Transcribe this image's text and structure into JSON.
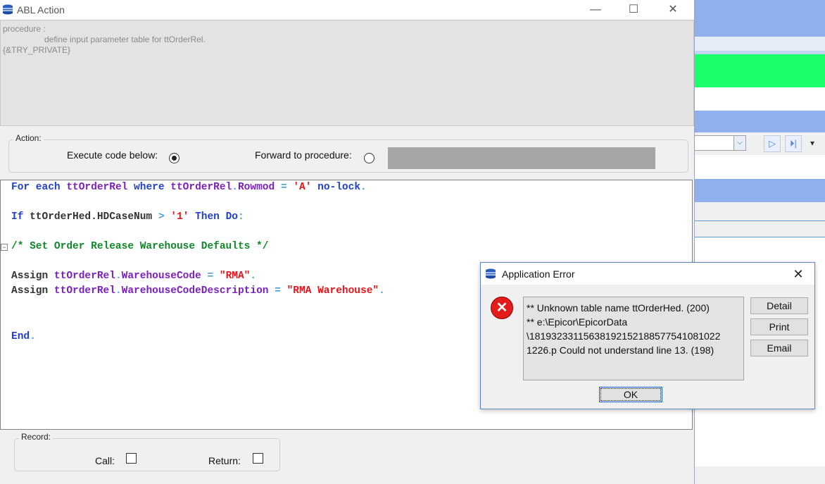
{
  "window": {
    "title": "ABL Action",
    "controls": {
      "minimize": "—",
      "maximize": "☐",
      "close": "✕"
    }
  },
  "description": {
    "line1": "procedure :",
    "line2": "define input parameter table for ttOrderRel.",
    "line3": "{&TRY_PRIVATE}"
  },
  "action_group": {
    "label": "Action:",
    "execute_label": "Execute code below:",
    "execute_selected": true,
    "forward_label": "Forward to procedure:",
    "forward_selected": false
  },
  "code": {
    "l1": {
      "kw1": "For each",
      "v1": "ttOrderRel",
      "kw2": "where",
      "v2": "ttOrderRel",
      "op1": ".",
      "f1": "Rowmod",
      "op2": " = ",
      "s1": "'A'",
      "kw3": "no-lock",
      "p1": "."
    },
    "l2": {
      "kw1": "If",
      "t1": "ttOrderHed.HDCaseNum",
      "op1": " > ",
      "s1": "'1'",
      "kw2": "Then",
      "kw3": "Do",
      "p1": ":"
    },
    "l3": {
      "c1": "/* Set Order Release Warehouse Defaults */"
    },
    "l4": {
      "kw1": "Assign",
      "v1": "ttOrderRel",
      "op1": ".",
      "f1": "WarehouseCode",
      "op2": " = ",
      "s1": "\"RMA\"",
      "p1": "."
    },
    "l5": {
      "kw1": "Assign",
      "v1": "ttOrderRel",
      "op1": ".",
      "f1": "WarehouseCodeDescription",
      "op2": " = ",
      "s1": "\"RMA Warehouse\"",
      "p1": "."
    },
    "l6": {
      "kw1": "End",
      "p1": "."
    },
    "fold_marker": "−"
  },
  "record_group": {
    "label": "Record:",
    "call_label": "Call:",
    "call_checked": false,
    "return_label": "Return:",
    "return_checked": false
  },
  "error_dialog": {
    "title": "Application Error",
    "close": "✕",
    "icon": "error-icon",
    "message": "** Unknown table name ttOrderHed. (200)\n** e:\\Epicor\\EpicorData\n\\18193233115638192152188577541081022\n1226.p Could not understand line 13. (198)",
    "buttons": {
      "detail": "Detail",
      "print": "Print",
      "email": "Email",
      "ok": "OK"
    }
  },
  "background_app": {
    "combo_arrow": "⌵",
    "nav_next": "▷",
    "nav_last": "⏵|",
    "more": "▾"
  },
  "colors": {
    "keyword": "#2040d0",
    "variable": "#7a1fc0",
    "string": "#e8141b",
    "comment": "#10882a",
    "operator": "#4a9fd8",
    "bg_blue": "#8fb0ec",
    "bg_green": "#1dff6a"
  }
}
